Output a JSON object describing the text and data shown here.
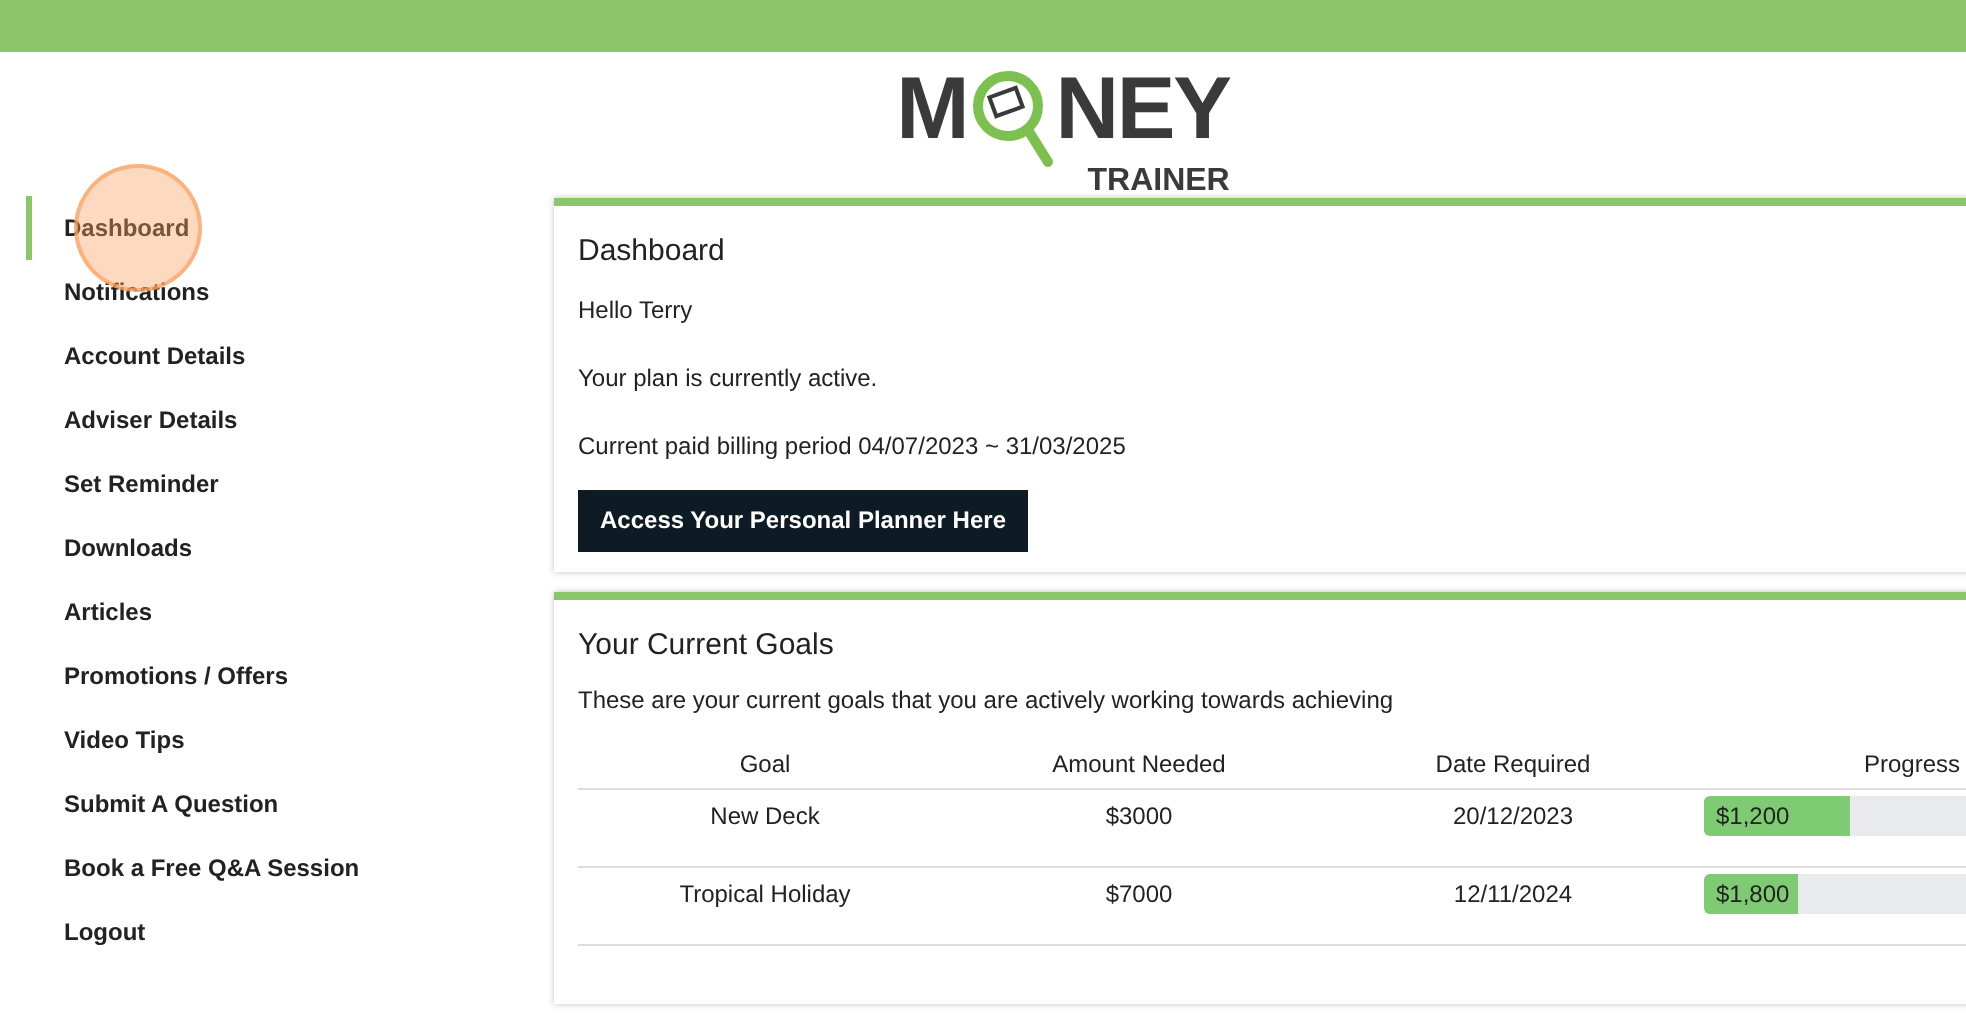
{
  "logo": {
    "left": "M",
    "right": "NEY",
    "tagline": "TRAINER"
  },
  "sidebar": {
    "items": [
      {
        "label": "Dashboard",
        "selected": true
      },
      {
        "label": "Notifications",
        "selected": false
      },
      {
        "label": "Account Details",
        "selected": false
      },
      {
        "label": "Adviser Details",
        "selected": false
      },
      {
        "label": "Set Reminder",
        "selected": false
      },
      {
        "label": "Downloads",
        "selected": false
      },
      {
        "label": "Articles",
        "selected": false
      },
      {
        "label": "Promotions / Offers",
        "selected": false
      },
      {
        "label": "Video Tips",
        "selected": false
      },
      {
        "label": "Submit A Question",
        "selected": false
      },
      {
        "label": "Book a Free Q&A Session",
        "selected": false
      },
      {
        "label": "Logout",
        "selected": false
      }
    ]
  },
  "dashboard": {
    "title": "Dashboard",
    "greeting": "Hello Terry",
    "status": "Your plan is currently active.",
    "billing": "Current paid billing period 04/07/2023 ~ 31/03/2025",
    "button": "Access Your Personal Planner Here"
  },
  "goals": {
    "title": "Your Current Goals",
    "description": "These are your current goals that you are actively working towards achieving",
    "columns": [
      "Goal",
      "Amount Needed",
      "Date Required",
      "Progress"
    ],
    "rows": [
      {
        "goal": "New Deck",
        "amount": "$3000",
        "date": "20/12/2023",
        "progress": "$1,200",
        "level": 0.4
      },
      {
        "goal": "Tropical Holiday",
        "amount": "$7000",
        "date": "12/11/2024",
        "progress": "$1,800",
        "level": 0.257
      }
    ]
  }
}
